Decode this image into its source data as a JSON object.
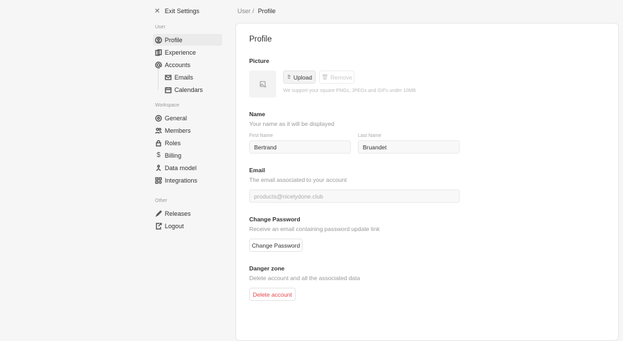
{
  "sidebar": {
    "exit_label": "Exit Settings",
    "sections": {
      "user": "User",
      "workspace": "Workspace",
      "other": "Other"
    },
    "items": {
      "profile": "Profile",
      "experience": "Experience",
      "accounts": "Accounts",
      "emails": "Emails",
      "calendars": "Calendars",
      "general": "General",
      "members": "Members",
      "roles": "Roles",
      "billing": "Billing",
      "data_model": "Data model",
      "integrations": "Integrations",
      "releases": "Releases",
      "logout": "Logout"
    }
  },
  "breadcrumb": {
    "parent": "User",
    "separator": "/",
    "current": "Profile"
  },
  "main": {
    "title": "Profile",
    "picture": {
      "label": "Picture",
      "upload": "Upload",
      "remove": "Remove",
      "hint": "We support your square PNGs, JPEGs and GIFs under 10MB"
    },
    "name": {
      "label": "Name",
      "description": "Your name as it will be displayed",
      "first_label": "First Name",
      "first_value": "Bertrand",
      "last_label": "Last Name",
      "last_value": "Bruandet"
    },
    "email": {
      "label": "Email",
      "description": "The email associated to your account",
      "value": "products@nicelydone.club"
    },
    "password": {
      "label": "Change Password",
      "description": "Receive an email containing password update link",
      "button": "Change Password"
    },
    "danger": {
      "label": "Danger zone",
      "description": "Delete account and all the associated data",
      "button": "Delete account"
    }
  },
  "colors": {
    "danger": "#e5484d",
    "active_bg": "#ebebeb"
  }
}
